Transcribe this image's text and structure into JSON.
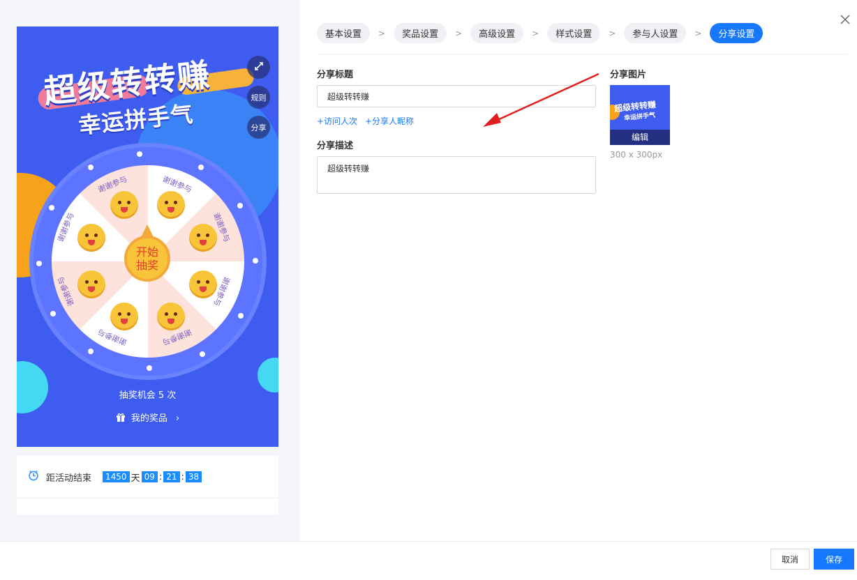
{
  "preview": {
    "title_main": "超级转转赚",
    "title_sub": "幸运拼手气",
    "side_buttons": {
      "expand_icon": "expand-icon",
      "rules": "规则",
      "share": "分享"
    },
    "wheel": {
      "segment_label": "谢谢参与",
      "start_line1": "开始",
      "start_line2": "抽奖"
    },
    "chances_text": "抽奖机会 5 次",
    "my_prize": "我的奖品",
    "my_prize_icon": "gift-icon",
    "my_prize_chevron": "chevron-right-icon",
    "countdown": {
      "label": "距活动结束",
      "days": "1450",
      "days_unit": "天",
      "hours": "09",
      "minutes": "21",
      "seconds": "38",
      "sep": ":",
      "icon": "clock-icon"
    },
    "colors": {
      "background": "#3f5cf0",
      "accent_yellow": "#f8c43a",
      "accent_cyan": "#45d8f2"
    }
  },
  "steps": [
    {
      "label": "基本设置"
    },
    {
      "label": "奖品设置"
    },
    {
      "label": "高级设置"
    },
    {
      "label": "样式设置"
    },
    {
      "label": "参与人设置"
    },
    {
      "label": "分享设置",
      "active": true
    }
  ],
  "step_separator": ">",
  "form": {
    "share_title_label": "分享标题",
    "share_title_value": "超级转转赚",
    "insert_visit_count": "+访问人次",
    "insert_sharer_nickname": "+分享人昵称",
    "share_desc_label": "分享描述",
    "share_desc_value": "超级转转赚",
    "share_image_label": "分享图片",
    "share_image_edit": "编辑",
    "share_image_size": "300 x 300px",
    "thumb_title": "超级转转赚",
    "thumb_sub": "幸运拼手气"
  },
  "footer": {
    "cancel": "取消",
    "save": "保存"
  },
  "close_icon": "close-icon",
  "accent_color": "#1677ff"
}
